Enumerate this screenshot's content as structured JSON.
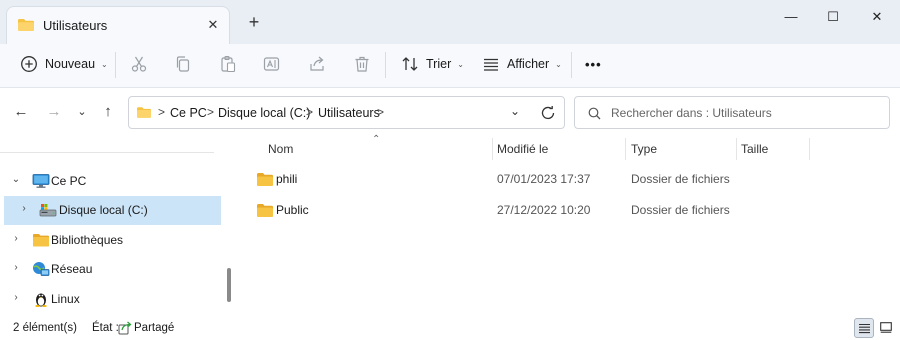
{
  "window": {
    "tab_title": "Utilisateurs",
    "tab_close": "✕",
    "new_tab": "+",
    "minimize": "—",
    "maximize": "☐",
    "close": "✕"
  },
  "toolbar": {
    "new_label": "Nouveau",
    "sort_label": "Trier",
    "view_label": "Afficher",
    "more": "•••",
    "icons": [
      "add-icon",
      "cut-icon",
      "copy-icon",
      "paste-icon",
      "rename-icon",
      "share-icon",
      "delete-icon",
      "sort-icon",
      "view-icon"
    ]
  },
  "address": {
    "breadcrumbs": [
      "Ce PC",
      "Disque local (C:)",
      "Utilisateurs"
    ],
    "separator": ">",
    "search_placeholder": "Rechercher dans : Utilisateurs"
  },
  "navigation": {
    "items": [
      {
        "label": "Ce PC",
        "icon": "computer-icon",
        "expanded": true
      },
      {
        "label": "Disque local (C:)",
        "icon": "drive-icon",
        "selected": true
      },
      {
        "label": "Bibliothèques",
        "icon": "library-icon"
      },
      {
        "label": "Réseau",
        "icon": "network-icon"
      },
      {
        "label": "Linux",
        "icon": "linux-icon"
      }
    ]
  },
  "files": {
    "columns": [
      "Nom",
      "Modifié le",
      "Type",
      "Taille"
    ],
    "rows": [
      {
        "name": "phili",
        "modified": "07/01/2023 17:37",
        "type": "Dossier de fichiers",
        "size": ""
      },
      {
        "name": "Public",
        "modified": "27/12/2022 10:20",
        "type": "Dossier de fichiers",
        "size": ""
      }
    ]
  },
  "status": {
    "count": "2 élément(s)",
    "state_label": "État :",
    "state_value": "Partagé"
  },
  "colors": {
    "selection": "#cce4f7",
    "folder": "#f6c442",
    "toolbar_bg": "#f7f9fc",
    "tab_strip_bg": "#e9eef5"
  }
}
